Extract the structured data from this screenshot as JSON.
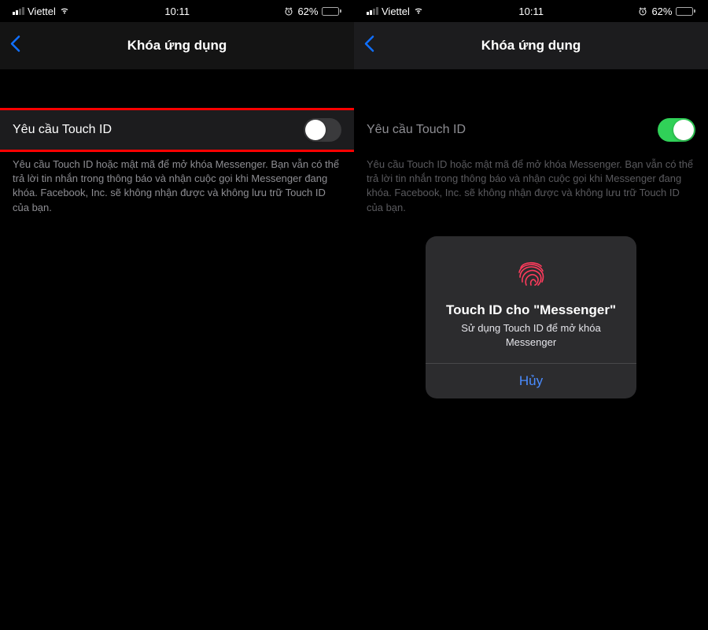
{
  "status": {
    "carrier": "Viettel",
    "time": "10:11",
    "battery_pct": "62%"
  },
  "left": {
    "nav_title": "Khóa ứng dụng",
    "row_label": "Yêu cầu Touch ID",
    "toggle_state": "off",
    "description": "Yêu cầu Touch ID hoặc mật mã để mở khóa Messenger. Bạn vẫn có thể trả lời tin nhắn trong thông báo và nhận cuộc gọi khi Messenger đang khóa. Facebook, Inc. sẽ không nhận được và không lưu trữ Touch ID của bạn."
  },
  "right": {
    "nav_title": "Khóa ứng dụng",
    "row_label": "Yêu cầu Touch ID",
    "toggle_state": "on",
    "description": "Yêu cầu Touch ID hoặc mật mã để mở khóa Messenger. Bạn vẫn có thể trả lời tin nhắn trong thông báo và nhận cuộc gọi khi Messenger đang khóa. Facebook, Inc. sẽ không nhận được và không lưu trữ Touch ID của bạn.",
    "modal": {
      "title": "Touch ID cho \"Messenger\"",
      "subtitle": "Sử dụng Touch ID để mở khóa Messenger",
      "cancel": "Hủy"
    }
  }
}
